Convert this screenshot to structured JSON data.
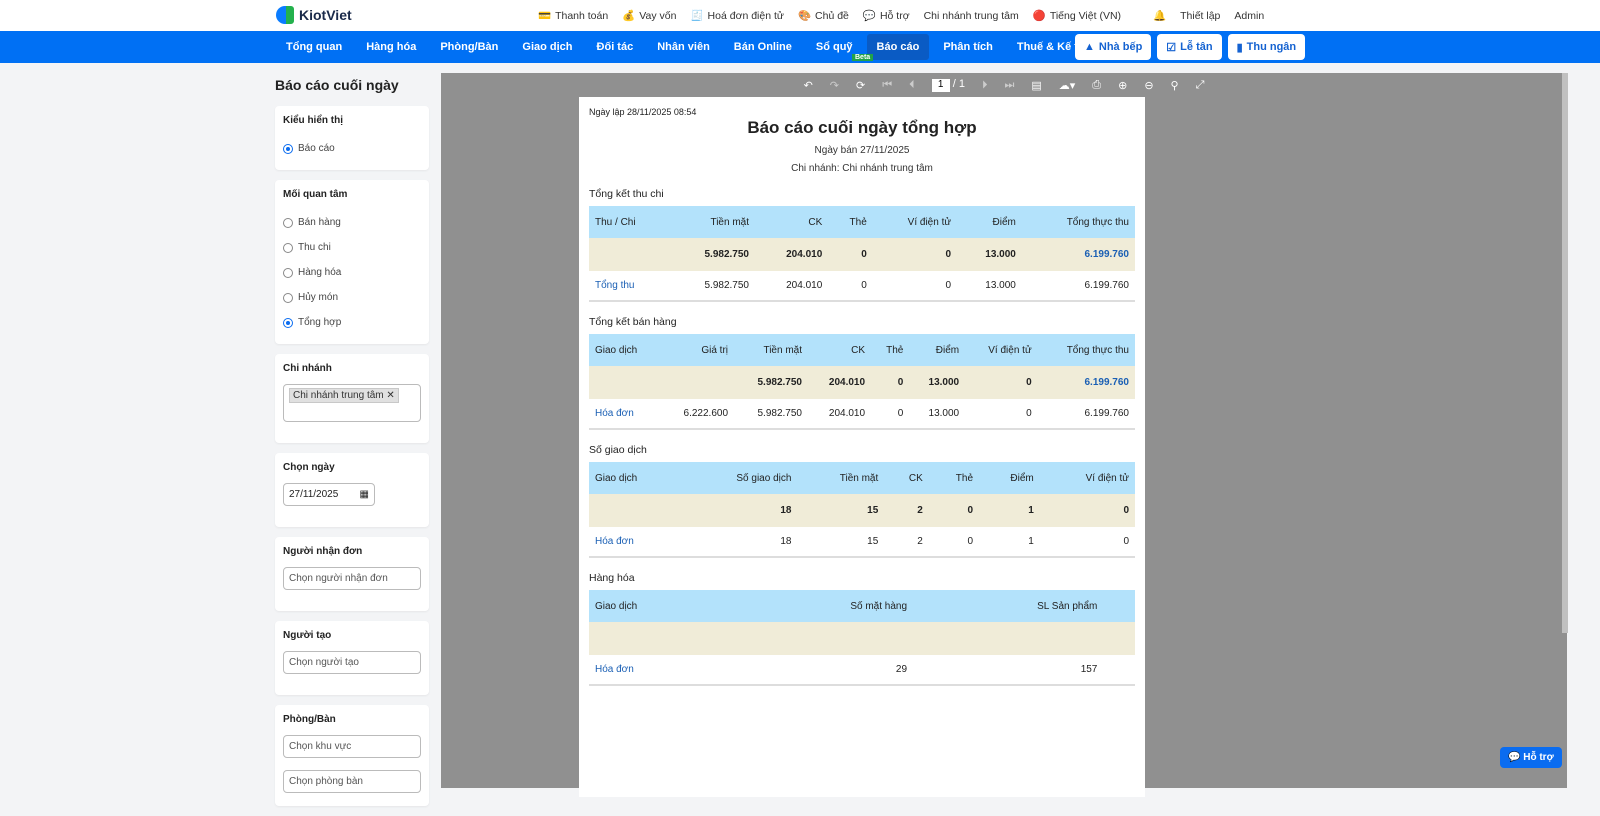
{
  "brand": "KiotViet",
  "toplinks": [
    "Thanh toán",
    "Vay vốn",
    "Hoá đơn điện tử",
    "Chủ đề",
    "Hỗ trợ",
    "Chi nhánh trung tâm",
    "Tiếng Việt (VN)",
    "Thiết lập",
    "Admin"
  ],
  "nav": [
    "Tổng quan",
    "Hàng hóa",
    "Phòng/Bàn",
    "Giao dịch",
    "Đối tác",
    "Nhân viên",
    "Bán Online",
    "Sổ quỹ",
    "Báo cáo",
    "Phân tích",
    "Thuế & Kế toán"
  ],
  "beta": "Beta",
  "navbtns": [
    "Nhà bếp",
    "Lễ tân",
    "Thu ngân"
  ],
  "left": {
    "title": "Báo cáo cuối ngày",
    "display": {
      "label": "Kiểu hiển thị",
      "options": [
        "Báo cáo"
      ]
    },
    "concern": {
      "label": "Mối quan tâm",
      "options": [
        "Bán hàng",
        "Thu chi",
        "Hàng hóa",
        "Hủy món",
        "Tổng hợp"
      ],
      "selected": "Tổng hợp"
    },
    "branch": {
      "label": "Chi nhánh",
      "tag": "Chi nhánh trung tâm"
    },
    "date": {
      "label": "Chọn ngày",
      "value": "27/11/2025"
    },
    "receiver": {
      "label": "Người nhận đơn",
      "placeholder": "Chọn người nhận đơn"
    },
    "creator": {
      "label": "Người tạo",
      "placeholder": "Chọn người tạo"
    },
    "room": {
      "label": "Phòng/Bàn",
      "area_placeholder": "Chọn khu vực",
      "room_placeholder": "Chọn phòng bàn"
    }
  },
  "viewer": {
    "page": "1",
    "total": "/ 1"
  },
  "report": {
    "created": "Ngày lập 28/11/2025 08:54",
    "title": "Báo cáo cuối ngày tổng hợp",
    "sale_date": "Ngày bán 27/11/2025",
    "branch": "Chi nhánh: Chi nhánh trung tâm",
    "t1": {
      "title": "Tổng kết thu chi",
      "headers": [
        "Thu / Chi",
        "Tiền mặt",
        "CK",
        "Thẻ",
        "Ví điện tử",
        "Điểm",
        "Tổng thực thu"
      ],
      "sum": [
        "",
        "5.982.750",
        "204.010",
        "0",
        "0",
        "13.000",
        "6.199.760"
      ],
      "row": [
        "Tổng thu",
        "5.982.750",
        "204.010",
        "0",
        "0",
        "13.000",
        "6.199.760"
      ]
    },
    "t2": {
      "title": "Tổng kết bán hàng",
      "headers": [
        "Giao dịch",
        "Giá trị",
        "Tiền mặt",
        "CK",
        "Thẻ",
        "Điểm",
        "Ví điện tử",
        "Tổng thực thu"
      ],
      "sum": [
        "",
        "",
        "5.982.750",
        "204.010",
        "0",
        "13.000",
        "0",
        "6.199.760"
      ],
      "row": [
        "Hóa đơn",
        "6.222.600",
        "5.982.750",
        "204.010",
        "0",
        "13.000",
        "0",
        "6.199.760"
      ]
    },
    "t3": {
      "title": "Số giao dịch",
      "headers": [
        "Giao dịch",
        "Số giao dịch",
        "Tiền mặt",
        "CK",
        "Thẻ",
        "Điểm",
        "Ví điện tử"
      ],
      "sum": [
        "",
        "18",
        "15",
        "2",
        "0",
        "1",
        "0"
      ],
      "row": [
        "Hóa đơn",
        "18",
        "15",
        "2",
        "0",
        "1",
        "0"
      ]
    },
    "t4": {
      "title": "Hàng hóa",
      "headers": [
        "Giao dịch",
        "Số mặt hàng",
        "SL Sản phẩm",
        ""
      ],
      "sum": [
        "",
        "",
        "",
        ""
      ],
      "row": [
        "Hóa đơn",
        "29",
        "157",
        ""
      ]
    }
  },
  "help": "Hỗ trợ"
}
